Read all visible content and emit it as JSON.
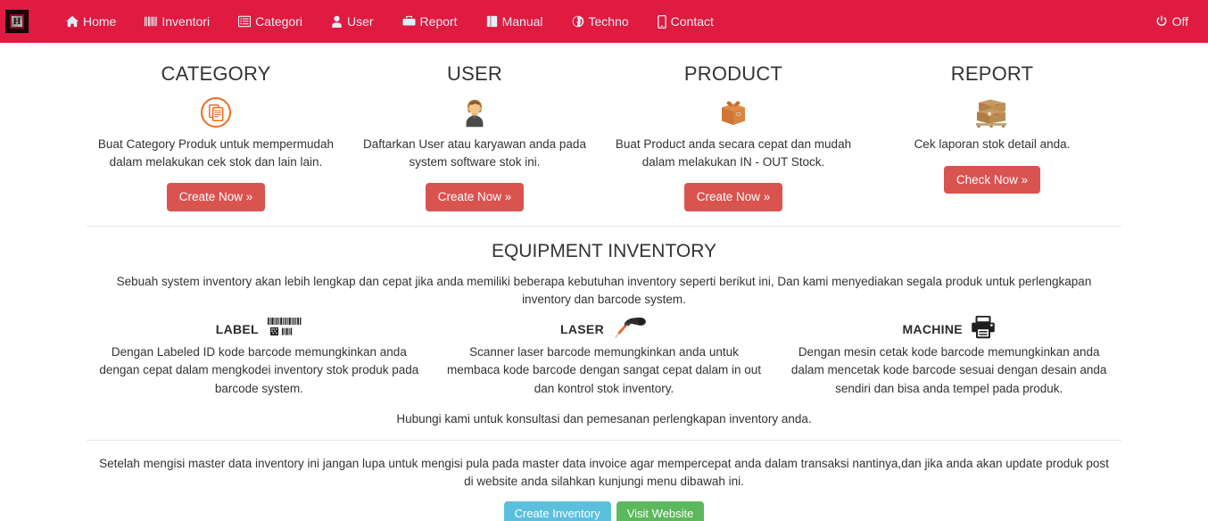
{
  "navbar": {
    "brand_glyph": "H",
    "brand_icon": "app-logo-icon",
    "items": [
      {
        "label": "Home",
        "icon": "home-icon"
      },
      {
        "label": "Inventori",
        "icon": "barcode-icon"
      },
      {
        "label": "Categori",
        "icon": "list-alt-icon"
      },
      {
        "label": "User",
        "icon": "user-icon"
      },
      {
        "label": "Report",
        "icon": "briefcase-icon"
      },
      {
        "label": "Manual",
        "icon": "book-icon"
      },
      {
        "label": "Techno",
        "icon": "globe-icon"
      },
      {
        "label": "Contact",
        "icon": "mobile-phone-icon"
      }
    ],
    "logout": {
      "label": "Off",
      "icon": "power-off-icon"
    },
    "background_color": "#e01a41",
    "text_color": "#dff0f5"
  },
  "cards": [
    {
      "title": "CATEGORY",
      "icon": "documents-circle-icon",
      "text": "Buat Category Produk untuk mempermudah dalam melakukan cek stok dan lain lain.",
      "button": "Create Now »",
      "button_style": "danger"
    },
    {
      "title": "USER",
      "icon": "person-avatar-icon",
      "text": "Daftarkan User atau karyawan anda pada system software stok ini.",
      "button": "Create Now »",
      "button_style": "danger"
    },
    {
      "title": "PRODUCT",
      "icon": "package-box-icon",
      "text": "Buat Product anda secara cepat dan mudah dalam melakukan IN - OUT Stock.",
      "button": "Create Now »",
      "button_style": "danger"
    },
    {
      "title": "REPORT",
      "icon": "stacked-boxes-pallet-icon",
      "text": "Cek laporan stok detail anda.",
      "button": "Check Now »",
      "button_style": "danger"
    }
  ],
  "equipment": {
    "title": "EQUIPMENT INVENTORY",
    "lead": "Sebuah system inventory akan lebih lengkap dan cepat jika anda memiliki beberapa kebutuhan inventory seperti berikut ini, Dan kami menyediakan segala produk untuk perlengkapan inventory dan barcode system.",
    "columns": [
      {
        "label": "LABEL",
        "icon": "barcode-label-icon",
        "text": "Dengan Labeled ID kode barcode memungkinkan anda dengan cepat dalam mengkodei inventory stok produk pada barcode system."
      },
      {
        "label": "LASER",
        "icon": "barcode-scanner-gun-icon",
        "text": "Scanner laser barcode memungkinkan anda untuk membaca kode barcode dengan sangat cepat dalam in out dan kontrol stok inventory."
      },
      {
        "label": "MACHINE",
        "icon": "printer-icon",
        "text": "Dengan mesin cetak kode barcode memungkinkan anda dalam mencetak kode barcode sesuai dengan desain anda sendiri dan bisa anda tempel pada produk."
      }
    ],
    "contact_line": "Hubungi kami untuk konsultasi dan pemesanan perlengkapan inventory anda."
  },
  "footer": {
    "note": "Setelah mengisi master data inventory ini jangan lupa untuk mengisi pula pada master data invoice agar mempercepat anda dalam transaksi nantinya,dan jika anda akan update produk post di website anda silahkan kunjungi menu dibawah ini.",
    "buttons": [
      {
        "label": "Create Inventory",
        "style": "info"
      },
      {
        "label": "Visit Website",
        "style": "success"
      }
    ]
  },
  "colors": {
    "brand_red": "#e01a41",
    "danger": "#d9534f",
    "info": "#5bc0de",
    "success": "#5cb85c",
    "accent_orange": "#f26b21"
  }
}
